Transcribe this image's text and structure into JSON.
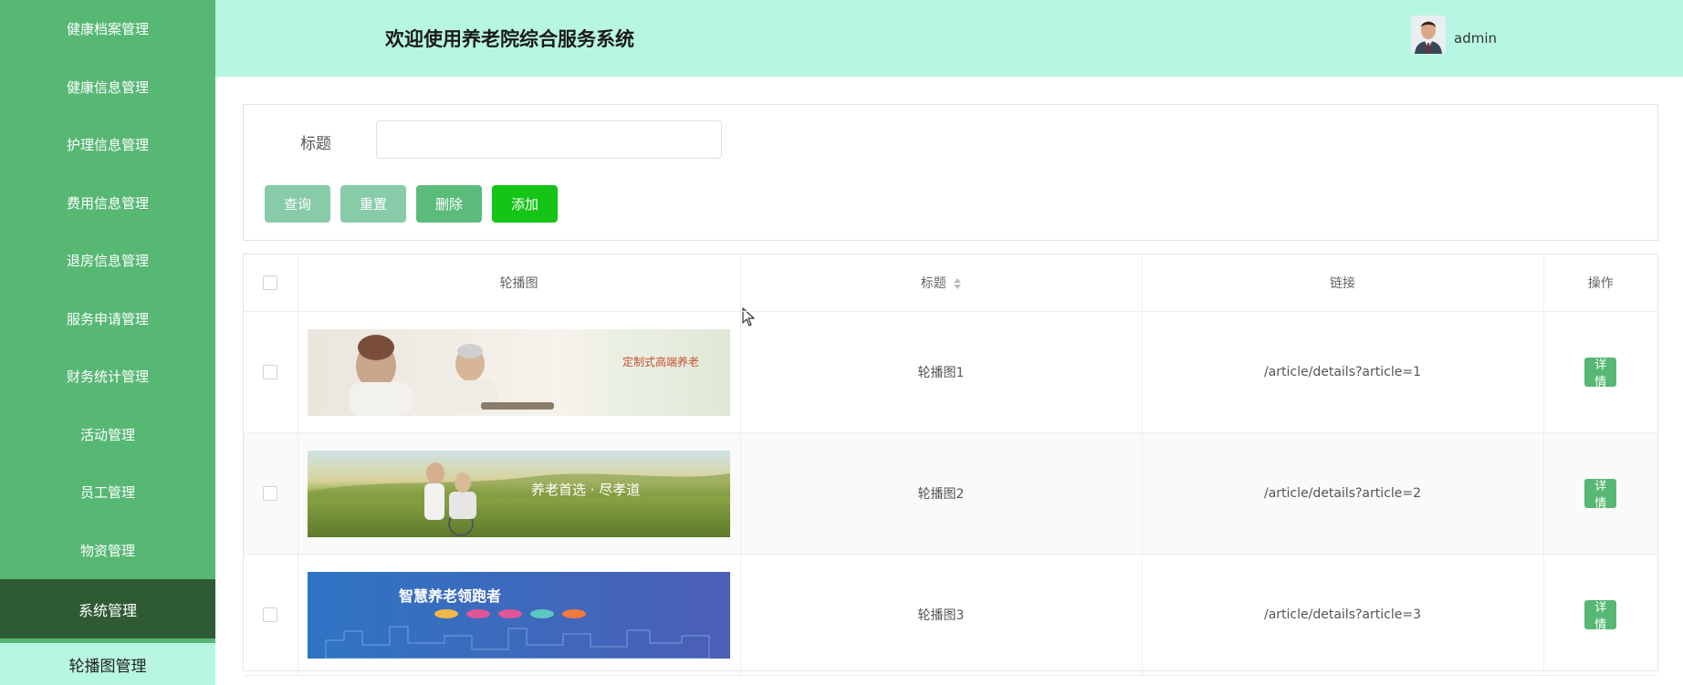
{
  "sidebar": {
    "items": [
      {
        "label": "健康档案管理"
      },
      {
        "label": "健康信息管理"
      },
      {
        "label": "护理信息管理"
      },
      {
        "label": "费用信息管理"
      },
      {
        "label": "退房信息管理"
      },
      {
        "label": "服务申请管理"
      },
      {
        "label": "财务统计管理"
      },
      {
        "label": "活动管理"
      },
      {
        "label": "员工管理"
      },
      {
        "label": "物资管理"
      }
    ],
    "active_item": {
      "label": "系统管理"
    },
    "sub_item": {
      "label": "轮播图管理"
    }
  },
  "header": {
    "title": "欢迎使用养老院综合服务系统",
    "username": "admin"
  },
  "search": {
    "label": "标题",
    "value": "",
    "buttons": {
      "query": "查询",
      "reset": "重置",
      "delete": "删除",
      "add": "添加"
    }
  },
  "table": {
    "columns": {
      "banner": "轮播图",
      "title": "标题",
      "link": "链接",
      "actions": "操作"
    },
    "rows": [
      {
        "banner_text": "定制式高端养老",
        "title": "轮播图1",
        "link": "/article/details?article=1",
        "action": "详情"
      },
      {
        "banner_text": "养老首选 · 尽孝道",
        "title": "轮播图2",
        "link": "/article/details?article=2",
        "action": "详情"
      },
      {
        "banner_text": "智慧养老领跑者",
        "title": "轮播图3",
        "link": "/article/details?article=3",
        "action": "详情"
      }
    ]
  },
  "colors": {
    "sidebar": "#57b874",
    "sidebar_active": "#2e5b34",
    "header": "#b8f6e4",
    "add_button": "#14c518"
  }
}
